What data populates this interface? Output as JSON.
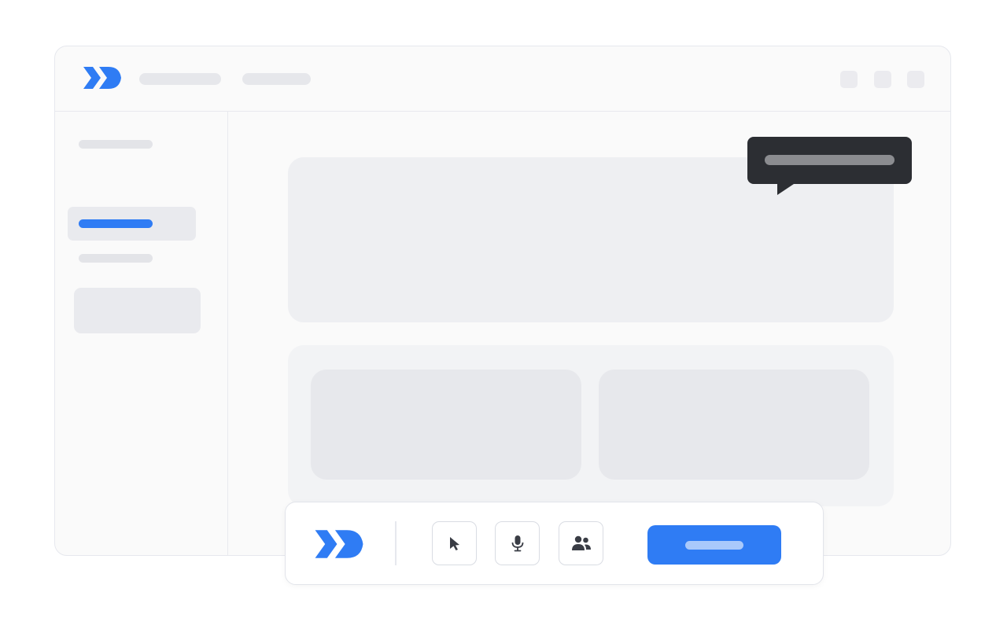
{
  "colors": {
    "accent": "#2f7cf4",
    "tooltip_background": "#2c2e33",
    "placeholder_fill": "#e9eaee"
  },
  "header": {
    "logo_icon": "double-chevron-logo",
    "window_controls": [
      "control-icon",
      "control-icon",
      "control-icon"
    ]
  },
  "sidebar": {
    "active_index": 1
  },
  "control_bar": {
    "logo_icon": "double-chevron-logo",
    "tools": [
      {
        "icon": "cursor-pointer-icon"
      },
      {
        "icon": "microphone-icon"
      },
      {
        "icon": "people-icon"
      }
    ]
  }
}
